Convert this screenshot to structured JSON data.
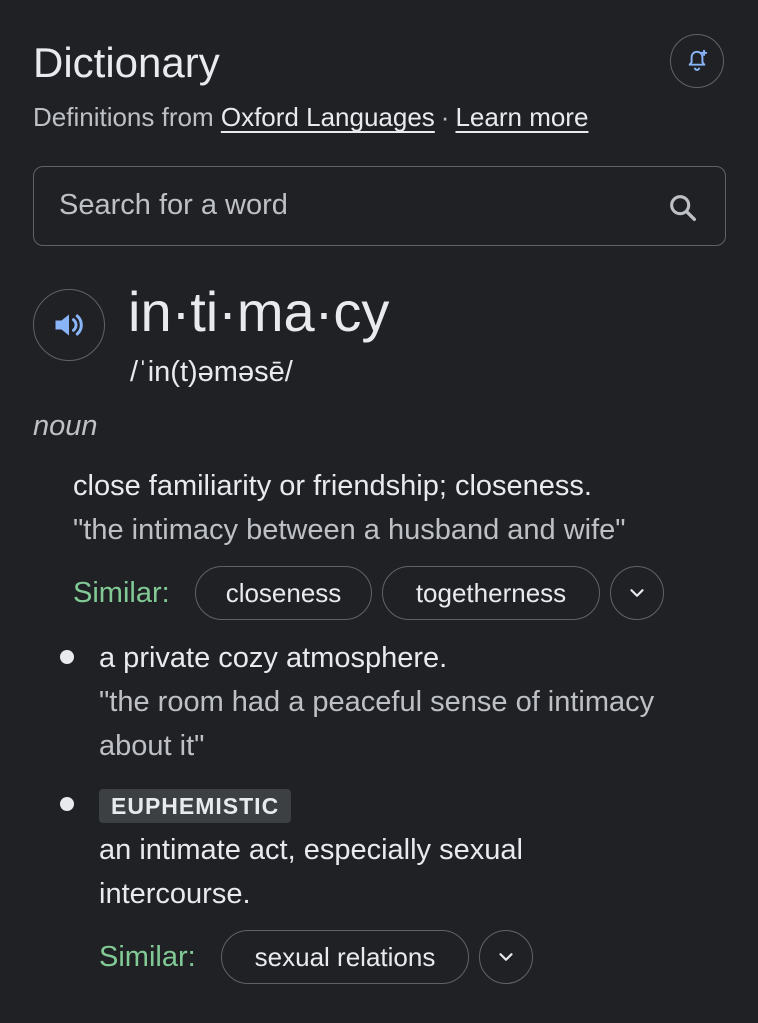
{
  "header": {
    "title": "Dictionary",
    "subtitle_prefix": "Definitions from",
    "source_link": "Oxford Languages",
    "separator": "·",
    "learn_more": "Learn more",
    "bell_icon": "bell-plus-icon"
  },
  "search": {
    "placeholder": "Search for a word",
    "value": "",
    "icon": "search-icon"
  },
  "entry": {
    "word": "in·ti·ma·cy",
    "pronunciation": "/ˈin(t)əməsē/",
    "audio_icon": "speaker-icon",
    "part_of_speech": "noun",
    "senses": [
      {
        "definition": "close familiarity or friendship; closeness.",
        "example": "\"the intimacy between a husband and wife\"",
        "similar_label": "Similar:",
        "similar": [
          "closeness",
          "togetherness"
        ]
      },
      {
        "definition": "a private cozy atmosphere.",
        "example_line1": "\"the room had a peaceful sense of intimacy",
        "example_line2": "about it\""
      },
      {
        "label": "EUPHEMISTIC",
        "definition_line1": "an intimate act, especially sexual",
        "definition_line2": "intercourse.",
        "similar_label": "Similar:",
        "similar": [
          "sexual relations"
        ]
      }
    ]
  },
  "colors": {
    "background": "#202124",
    "text": "#e8eaed",
    "muted": "#bdc1c6",
    "similar_green": "#81c995",
    "speaker_blue": "#8ab4f8",
    "border": "#5f6368"
  }
}
